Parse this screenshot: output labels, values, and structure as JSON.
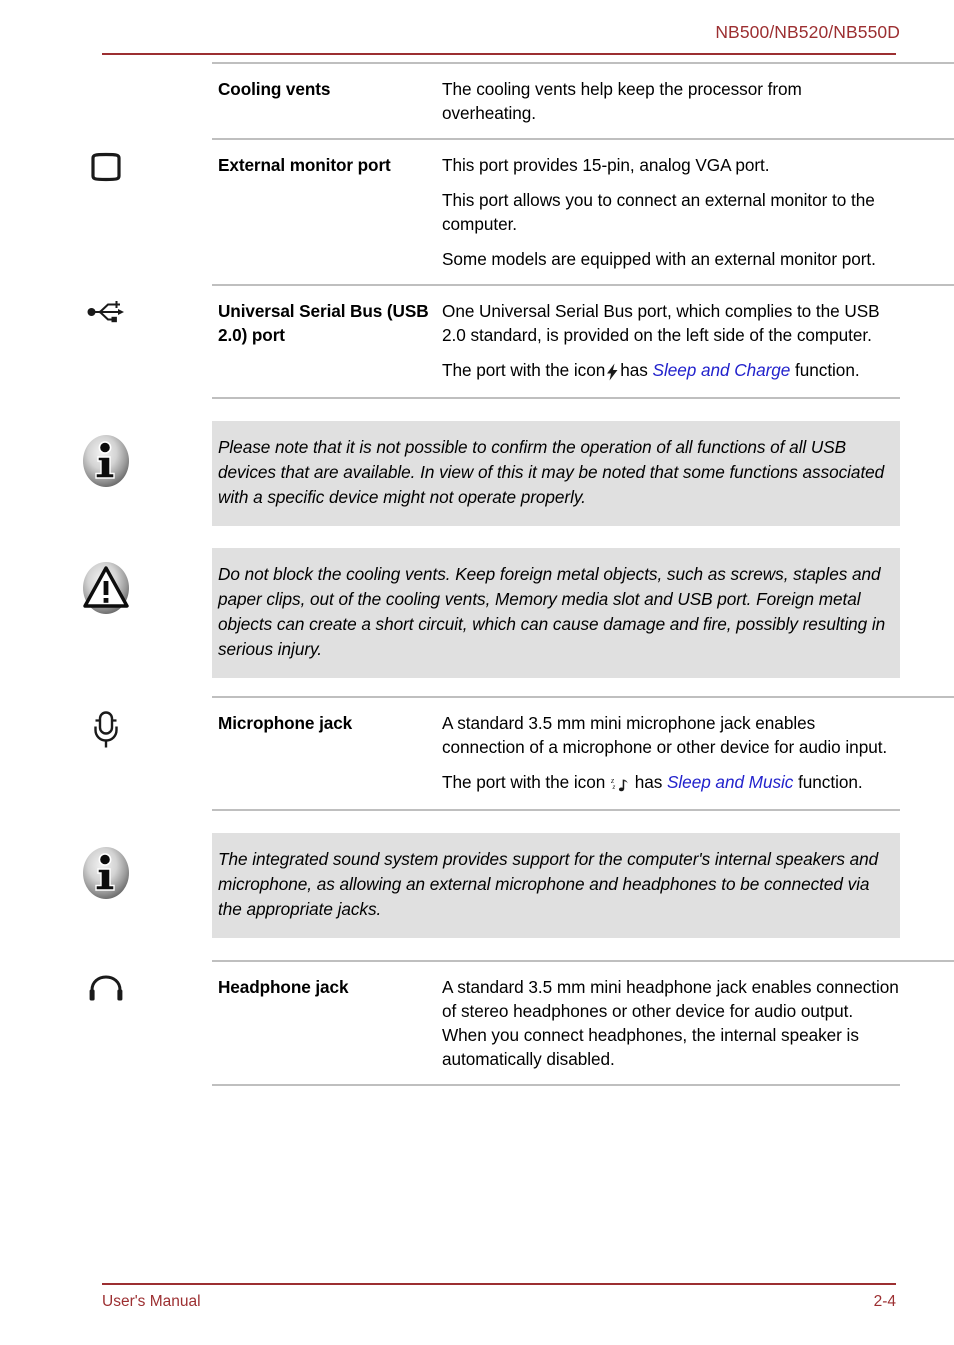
{
  "header": {
    "model_line": "NB500/NB520/NB550D"
  },
  "footer": {
    "left": "User's Manual",
    "page_number": "2-4"
  },
  "colors": {
    "brand_maroon": "#9c2f31",
    "link_blue": "#2222cc",
    "note_background": "#e0e0e0",
    "rule_gray": "#bfbfbf"
  },
  "rows": [
    {
      "icon": "none",
      "label": "Cooling vents",
      "paragraphs": [
        "The cooling vents help keep the processor from overheating."
      ]
    },
    {
      "icon": "vga-port-icon",
      "label": "External monitor port",
      "paragraphs": [
        "This port provides 15-pin, analog VGA port.",
        "This port allows you to connect an external monitor to the computer.",
        "Some models are equipped with an external monitor port."
      ]
    },
    {
      "icon": "usb-icon",
      "label": "Universal Serial Bus (USB 2.0) port",
      "paragraphs": [
        "One Universal Serial Bus port, which complies to the USB 2.0 standard, is provided on the left side of the computer."
      ],
      "link_paragraph": {
        "before": "The port with the icon",
        "glyph": "lightning-bolt-icon",
        "middle": "has",
        "link": "Sleep and Charge",
        "after": "function."
      }
    }
  ],
  "note_usb": {
    "icon": "info-icon",
    "text": "Please note that it is not possible to confirm the operation of all functions of all USB devices that are available. In view of this it may be noted that some functions associated with a specific device might not operate properly."
  },
  "note_warning": {
    "icon": "warning-triangle-icon",
    "text": "Do not block the cooling vents. Keep foreign metal objects, such as screws, staples and paper clips, out of the cooling vents, Memory media slot and USB port. Foreign metal objects can create a short circuit, which can cause damage and fire, possibly resulting in serious injury."
  },
  "row_microphone": {
    "icon": "microphone-icon",
    "label": "Microphone jack",
    "paragraphs": [
      "A standard 3.5 mm mini microphone jack enables connection of a microphone or other device for audio input."
    ],
    "link_paragraph": {
      "before": "The port with the icon",
      "glyph": "sleep-music-icon",
      "middle": "has",
      "link": "Sleep and Music",
      "after": "function."
    }
  },
  "note_sound": {
    "icon": "info-icon",
    "text": "The integrated sound system provides support for the computer's internal speakers and microphone, as allowing an external microphone and headphones to be connected via the appropriate jacks."
  },
  "row_headphone": {
    "icon": "headphone-icon",
    "label": "Headphone jack",
    "paragraphs": [
      "A standard 3.5 mm mini headphone jack enables connection of stereo headphones or other device for audio output. When you connect headphones, the internal speaker is automatically disabled."
    ]
  }
}
